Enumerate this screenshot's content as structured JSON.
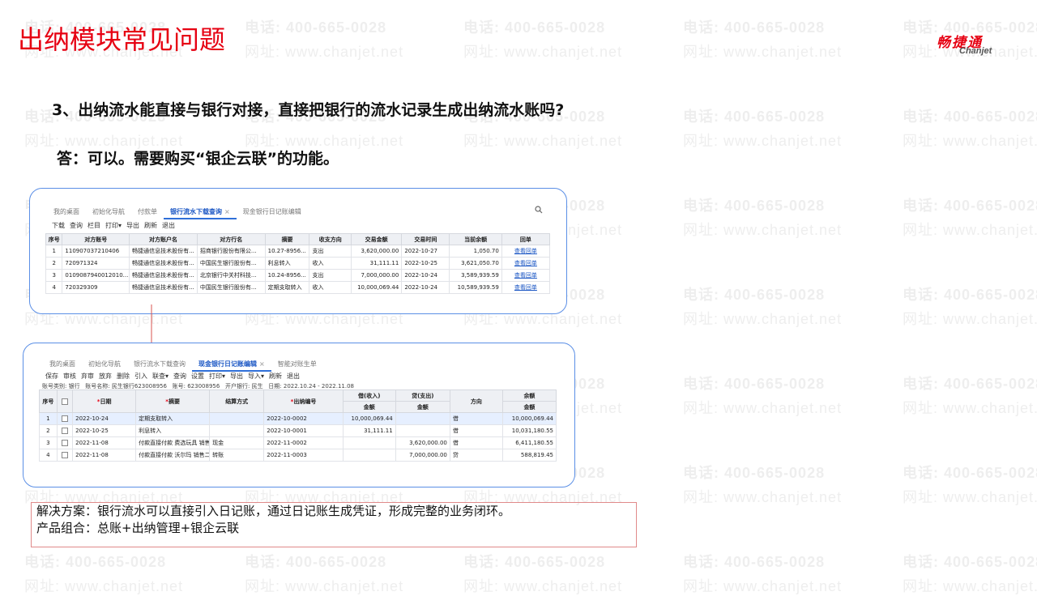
{
  "watermark": {
    "phone": "电话: 400-665-0028",
    "site": "网址: www.chanjet.net"
  },
  "slide_title": "出纳模块常见问题",
  "logo": {
    "cn": "畅捷通",
    "en": "Chanjet"
  },
  "question": "3、出纳流水能直接与银行对接，直接把银行的流水记录生成出纳流水账吗?",
  "answer": "答：可以。需要购买“银企云联”的功能。",
  "screen1": {
    "tabs": [
      "我的桌面",
      "初始化导航",
      "付款单",
      "银行流水下载查询",
      "现金银行日记账编辑"
    ],
    "active_tab": 3,
    "toolbar": [
      "下载",
      "查询",
      "栏目",
      "打印▾",
      "导出",
      "刷新",
      "退出"
    ],
    "columns": [
      "序号",
      "对方账号",
      "对方账户名",
      "对方行名",
      "摘要",
      "收支方向",
      "交易金额",
      "交易时间",
      "当前余额",
      "回单"
    ],
    "rows": [
      [
        "1",
        "110907037210406",
        "畅捷通信息技术股份有...",
        "招商银行股份有限公...",
        "10.27-8956...",
        "支出",
        "3,620,000.00",
        "2022-10-27",
        "1,050.70",
        "查看回单"
      ],
      [
        "2",
        "720971324",
        "畅捷通信息技术股份有...",
        "中国民生银行股份有...",
        "利息转入",
        "收入",
        "31,111.11",
        "2022-10-25",
        "3,621,050.70",
        "查看回单"
      ],
      [
        "3",
        "0109087940012010...",
        "畅捷通信息技术股份有...",
        "北京银行中关村科技...",
        "10.24-8956...",
        "支出",
        "7,000,000.00",
        "2022-10-24",
        "3,589,939.59",
        "查看回单"
      ],
      [
        "4",
        "720329309",
        "畅捷通信息技术股份有...",
        "中国民生银行股份有...",
        "定期支取转入",
        "收入",
        "10,000,069.44",
        "2022-10-24",
        "10,589,939.59",
        "查看回单"
      ]
    ]
  },
  "screen2": {
    "tabs": [
      "我的桌面",
      "初始化导航",
      "银行流水下载查询",
      "现金银行日记账编辑",
      "智能对账生单"
    ],
    "active_tab": 3,
    "toolbar": [
      "保存",
      "审核",
      "弃审",
      "放弃",
      "删除",
      "引入",
      "联查▾",
      "查询",
      "设置",
      "打印▾",
      "导出",
      "导入▾",
      "刷新",
      "退出"
    ],
    "meta": {
      "kind": "账号类别: 银行",
      "name": "账号名称: 民生银行623008956",
      "acct": "账号: 623008956",
      "bank": "开户银行: 民生",
      "date": "日期: 2022.10.24 - 2022.11.08"
    },
    "columns": {
      "seq": "序号",
      "date": "日期",
      "summary": "摘要",
      "settle": "结算方式",
      "cashno": "出纳编号",
      "debit": "借(收入)",
      "credit": "贷(支出)",
      "amount": "金额",
      "direction": "方向",
      "balance": "余额"
    },
    "rows": [
      [
        "1",
        "2022-10-24",
        "定期支取转入",
        "",
        "2022-10-0002",
        "10,000,069.44",
        "",
        "借",
        "10,000,069.44"
      ],
      [
        "2",
        "2022-10-25",
        "利息转入",
        "",
        "2022-10-0001",
        "31,111.11",
        "",
        "借",
        "10,031,180.55"
      ],
      [
        "3",
        "2022-11-08",
        "付款直接付款 费选玩具 销售...",
        "现金",
        "2022-11-0002",
        "",
        "3,620,000.00",
        "借",
        "6,411,180.55"
      ],
      [
        "4",
        "2022-11-08",
        "付款直接付款 沃尔玛 销售二...",
        "转账",
        "2022-11-0003",
        "",
        "7,000,000.00",
        "贷",
        "588,819.45"
      ]
    ]
  },
  "solution": {
    "line1": "解决方案：银行流水可以直接引入日记账，通过日记账生成凭证，形成完整的业务闭环。",
    "line2": "产品组合：总账+出纳管理+银企云联"
  }
}
